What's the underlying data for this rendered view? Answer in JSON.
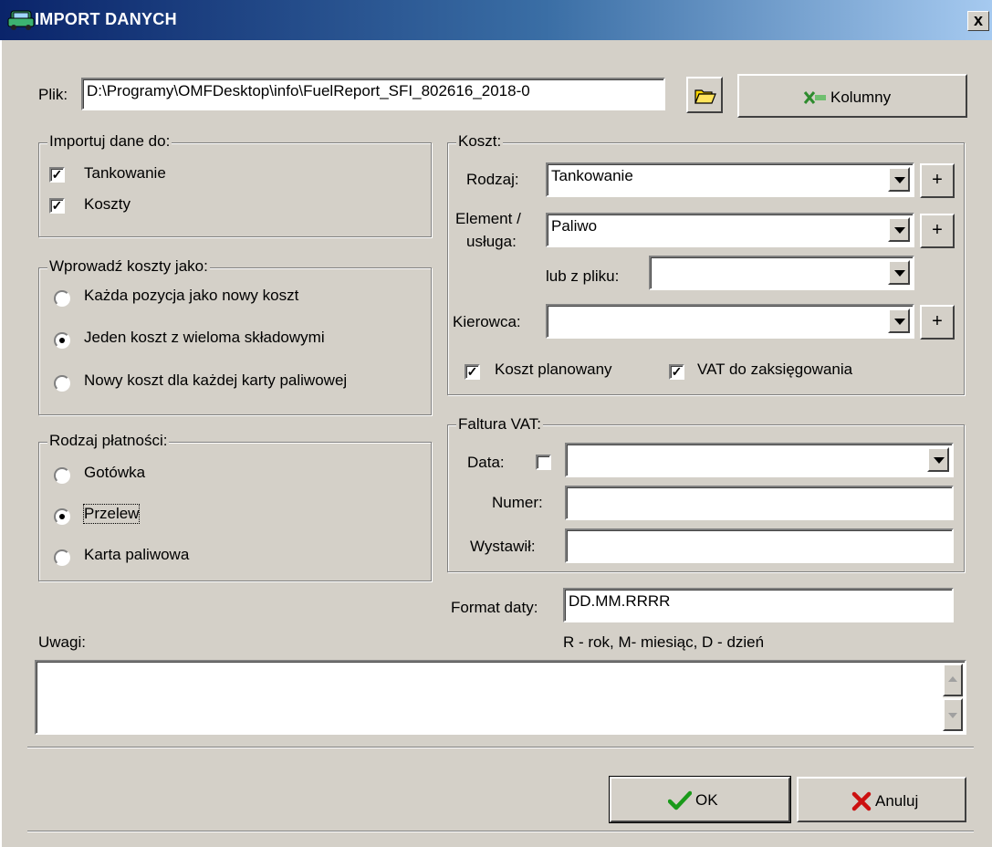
{
  "window": {
    "title": "IMPORT DANYCH",
    "close": "x"
  },
  "file": {
    "label": "Plik:",
    "value": "D:\\Programy\\OMFDesktop\\info\\FuelReport_SFI_802616_2018-0",
    "columns_button": "Kolumny"
  },
  "import_to": {
    "legend": "Importuj dane do:",
    "options": [
      {
        "label": "Tankowanie",
        "checked": true
      },
      {
        "label": "Koszty",
        "checked": true
      }
    ]
  },
  "enter_costs": {
    "legend": "Wprowadź koszty jako:",
    "options": [
      {
        "label": "Każda pozycja jako nowy koszt",
        "selected": false
      },
      {
        "label": "Jeden koszt z wieloma składowymi",
        "selected": true
      },
      {
        "label": "Nowy koszt dla każdej karty paliwowej",
        "selected": false
      }
    ]
  },
  "payment": {
    "legend": "Rodzaj płatności:",
    "options": [
      {
        "label": "Gotówka",
        "selected": false
      },
      {
        "label": "Przelew",
        "selected": true
      },
      {
        "label": "Karta paliwowa",
        "selected": false
      }
    ]
  },
  "cost": {
    "legend": "Koszt:",
    "type_label": "Rodzaj:",
    "type_value": "Tankowanie",
    "element_label_1": "Element /",
    "element_label_2": "usługa:",
    "element_value": "Paliwo",
    "from_file_label": "lub z pliku:",
    "from_file_value": "",
    "driver_label": "Kierowca:",
    "driver_value": "",
    "add": "+",
    "planned_label": "Koszt planowany",
    "planned_checked": true,
    "vat_label": "VAT do zaksięgowania",
    "vat_checked": true
  },
  "invoice": {
    "legend": "Faltura VAT:",
    "date_label": "Data:",
    "date_checked": false,
    "date_value": "",
    "number_label": "Numer:",
    "number_value": "",
    "issuer_label": "Wystawił:",
    "issuer_value": ""
  },
  "date_format": {
    "label": "Format daty:",
    "value": "DD.MM.RRRR",
    "hint": "R - rok, M- miesiąc, D - dzień"
  },
  "notes": {
    "label": "Uwagi:",
    "value": ""
  },
  "buttons": {
    "ok": "OK",
    "cancel": "Anuluj"
  },
  "colors": {
    "titlebar_start": "#0a246a",
    "titlebar_end": "#a6caf0",
    "face": "#d4d0c8",
    "ok_check": "#1a9a1a",
    "cancel_x": "#cc1010",
    "columns_icon": "#2e8b2e"
  }
}
